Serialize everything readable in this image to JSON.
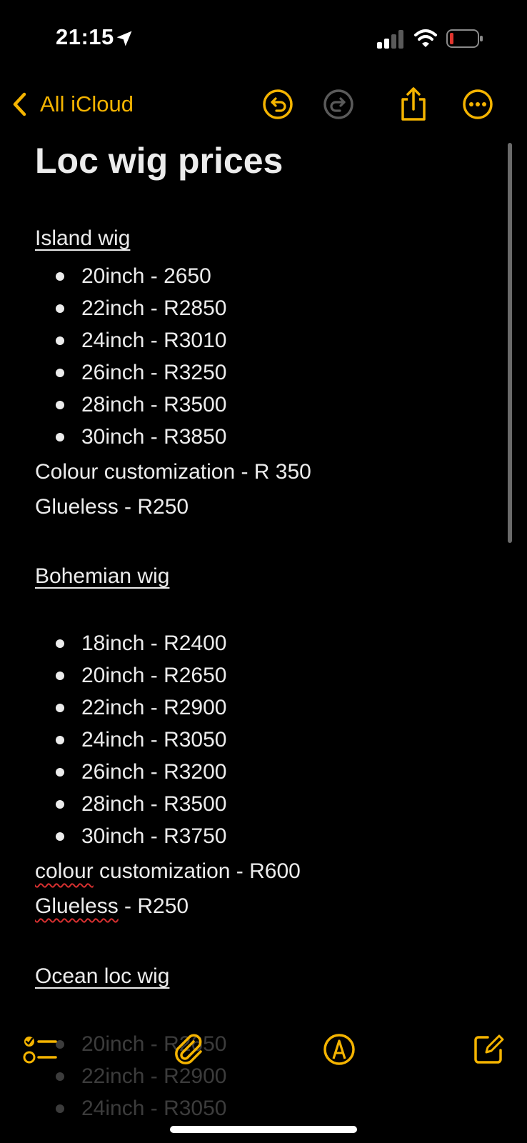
{
  "status_bar": {
    "time": "21:15",
    "icons": [
      "location-arrow-icon",
      "signal-icon",
      "wifi-icon",
      "battery-low-icon"
    ],
    "battery_color": "#e0352e"
  },
  "nav": {
    "back_label": "All iCloud",
    "icons": [
      "undo-icon",
      "redo-icon",
      "share-icon",
      "more-icon"
    ],
    "accent": "#F5B400"
  },
  "note": {
    "title": "Loc wig prices",
    "sections": [
      {
        "heading": "Island wig",
        "items": [
          "20inch - 2650",
          "22inch - R2850",
          "24inch - R3010",
          "26inch - R3250",
          "28inch - R3500",
          "30inch - R3850"
        ],
        "extra": [
          "Colour customization - R 350",
          "Glueless - R250"
        ]
      },
      {
        "heading": "Bohemian wig",
        "items": [
          "18inch - R2400",
          "20inch - R2650",
          "22inch - R2900",
          "24inch - R3050",
          "26inch - R3200",
          "28inch - R3500",
          "30inch - R3750"
        ],
        "extra": [
          {
            "word": "colour",
            "rest": " customization - R600"
          },
          {
            "word": "Glueless",
            "rest": " - R250"
          }
        ]
      },
      {
        "heading": "Ocean loc wig",
        "items": [
          "20inch - R2650",
          "22inch - R2900",
          "24inch - R3050"
        ]
      }
    ]
  },
  "toolbar": {
    "icons": [
      "checklist-icon",
      "paperclip-icon",
      "markup-pen-icon",
      "compose-icon"
    ]
  }
}
